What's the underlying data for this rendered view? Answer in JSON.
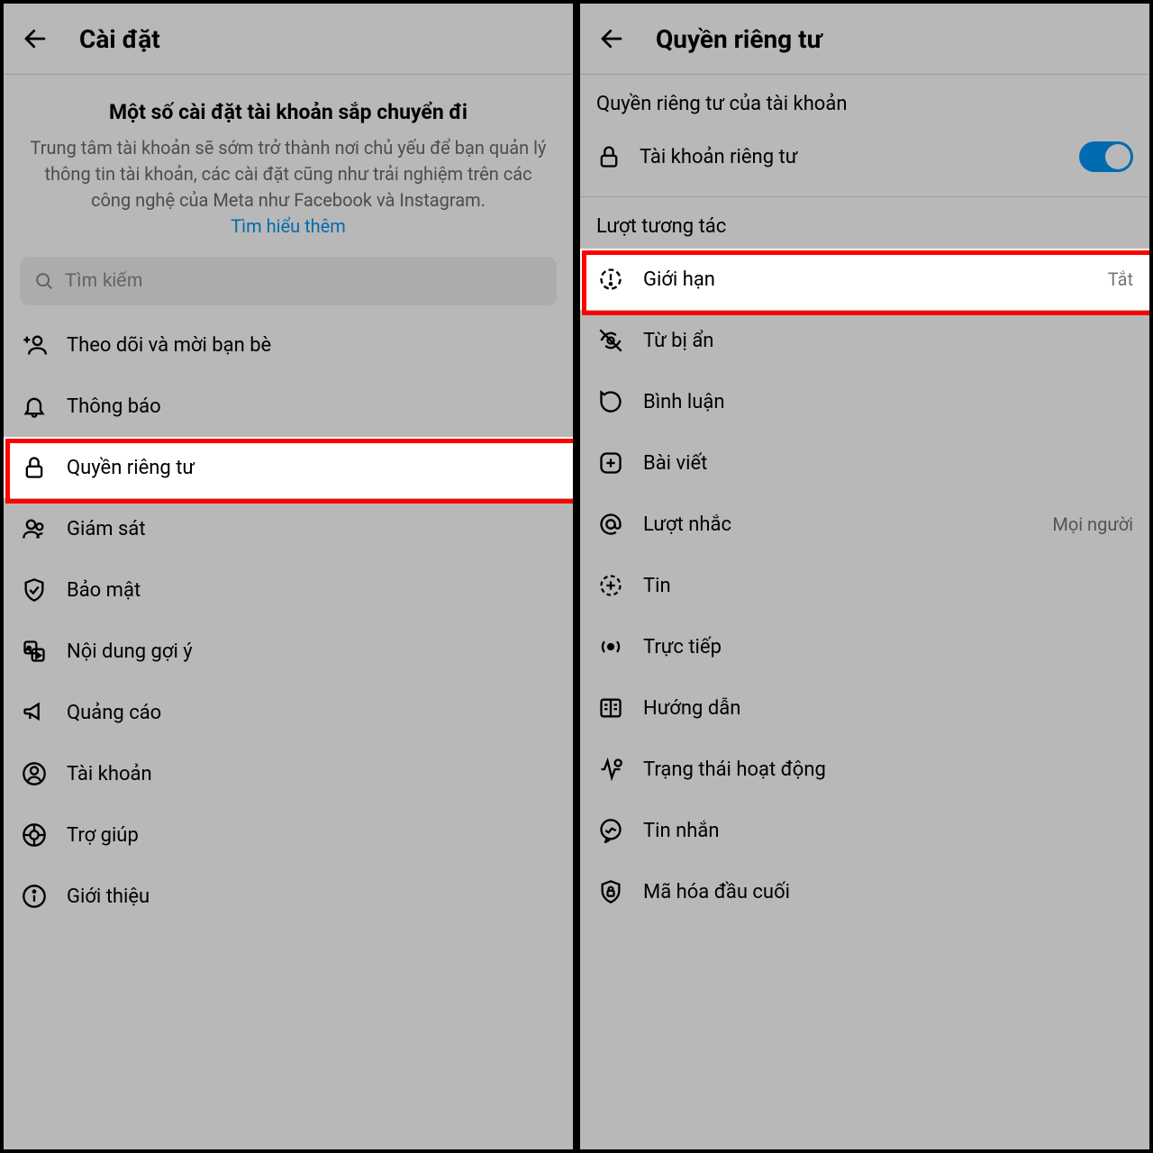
{
  "left": {
    "header_title": "Cài đặt",
    "info_title": "Một số cài đặt tài khoản sắp chuyển đi",
    "info_text": "Trung tâm tài khoản sẽ sớm trở thành nơi chủ yếu để bạn quản lý thông tin tài khoản, các cài đặt cũng như trải nghiệm trên các công nghệ của Meta như Facebook và Instagram.",
    "info_link": "Tìm hiểu thêm",
    "search_placeholder": "Tìm kiếm",
    "items": [
      {
        "icon": "person-plus",
        "label": "Theo dõi và mời bạn bè"
      },
      {
        "icon": "bell",
        "label": "Thông báo"
      },
      {
        "icon": "lock",
        "label": "Quyền riêng tư",
        "highlighted": true
      },
      {
        "icon": "people",
        "label": "Giám sát"
      },
      {
        "icon": "shield",
        "label": "Bảo mật"
      },
      {
        "icon": "content",
        "label": "Nội dung gợi ý"
      },
      {
        "icon": "megaphone",
        "label": "Quảng cáo"
      },
      {
        "icon": "account",
        "label": "Tài khoản"
      },
      {
        "icon": "help",
        "label": "Trợ giúp"
      },
      {
        "icon": "info",
        "label": "Giới thiệu"
      }
    ]
  },
  "right": {
    "header_title": "Quyền riêng tư",
    "section_account": "Quyền riêng tư của tài khoản",
    "private_account_label": "Tài khoản riêng tư",
    "private_account_on": true,
    "section_interactions": "Lượt tương tác",
    "items": [
      {
        "icon": "limits",
        "label": "Giới hạn",
        "value": "Tắt",
        "highlighted": true
      },
      {
        "icon": "hidden",
        "label": "Từ bị ẩn"
      },
      {
        "icon": "comment",
        "label": "Bình luận"
      },
      {
        "icon": "post",
        "label": "Bài viết"
      },
      {
        "icon": "mention",
        "label": "Lượt nhắc",
        "value": "Mọi người"
      },
      {
        "icon": "story",
        "label": "Tin"
      },
      {
        "icon": "live",
        "label": "Trực tiếp"
      },
      {
        "icon": "guide",
        "label": "Hướng dẫn"
      },
      {
        "icon": "activity",
        "label": "Trạng thái hoạt động"
      },
      {
        "icon": "messages",
        "label": "Tin nhắn"
      },
      {
        "icon": "encrypt",
        "label": "Mã hóa đầu cuối"
      }
    ]
  }
}
